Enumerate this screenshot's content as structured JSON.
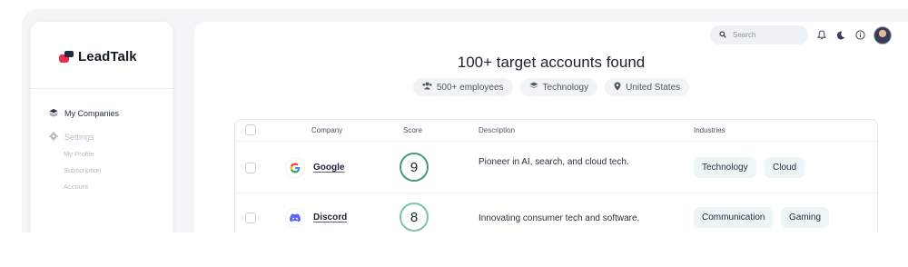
{
  "brand": {
    "name": "LeadTalk"
  },
  "sidebar": {
    "items": [
      {
        "label": "My Companies"
      },
      {
        "label": "Settings"
      }
    ],
    "sub_items": [
      "My Profile",
      "Subscription",
      "Account"
    ]
  },
  "topbar": {
    "search_placeholder": "Search"
  },
  "main": {
    "title": "100+ target accounts found",
    "filters": [
      {
        "label": "500+ employees",
        "icon": "users-icon"
      },
      {
        "label": "Technology",
        "icon": "layers-icon"
      },
      {
        "label": "United States",
        "icon": "location-pin-icon"
      }
    ]
  },
  "table": {
    "columns": [
      "Company",
      "Score",
      "Description",
      "Industries"
    ],
    "rows": [
      {
        "company": "Google",
        "score": "9",
        "description": "Pioneer in AI, search, and cloud tech.",
        "industries": [
          "Technology",
          "Cloud"
        ]
      },
      {
        "company": "Discord",
        "score": "8",
        "description": "Innovating consumer tech and software.",
        "industries": [
          "Communication",
          "Gaming"
        ]
      }
    ]
  },
  "colors": {
    "brand_red": "#ee2c4f",
    "score_high": "#4a9a74",
    "score_mid": "#7dc5a0",
    "discord": "#5865f2"
  }
}
